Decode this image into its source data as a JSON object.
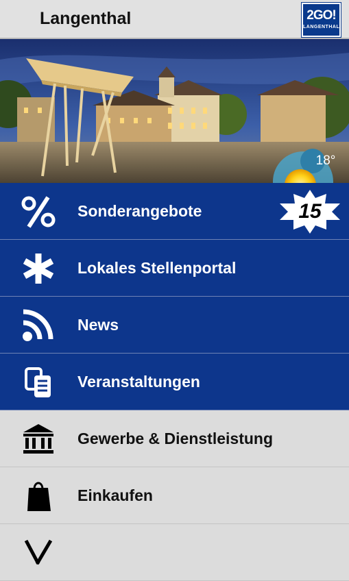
{
  "header": {
    "title": "Langenthal",
    "logo_line1": "2GO!",
    "logo_line2": "LANGENTHAL"
  },
  "hero": {
    "temperature": "18°",
    "weather_icon": "sun-icon"
  },
  "menu": [
    {
      "label": "Sonderangebote",
      "icon": "percent-icon",
      "badge": "15",
      "style": "blue"
    },
    {
      "label": "Lokales Stellenportal",
      "icon": "asterisk-icon",
      "style": "blue"
    },
    {
      "label": "News",
      "icon": "rss-icon",
      "style": "blue"
    },
    {
      "label": "Veranstaltungen",
      "icon": "tickets-icon",
      "style": "blue"
    },
    {
      "label": "Gewerbe & Dienstleistung",
      "icon": "bank-building-icon",
      "style": "grey"
    },
    {
      "label": "Einkaufen",
      "icon": "shopping-bag-icon",
      "style": "grey"
    },
    {
      "label": "",
      "icon": "fork-knife-icon",
      "style": "grey"
    }
  ],
  "colors": {
    "primary": "#0d368c",
    "grey": "#dcdcdc",
    "header": "#e1e1e1"
  }
}
